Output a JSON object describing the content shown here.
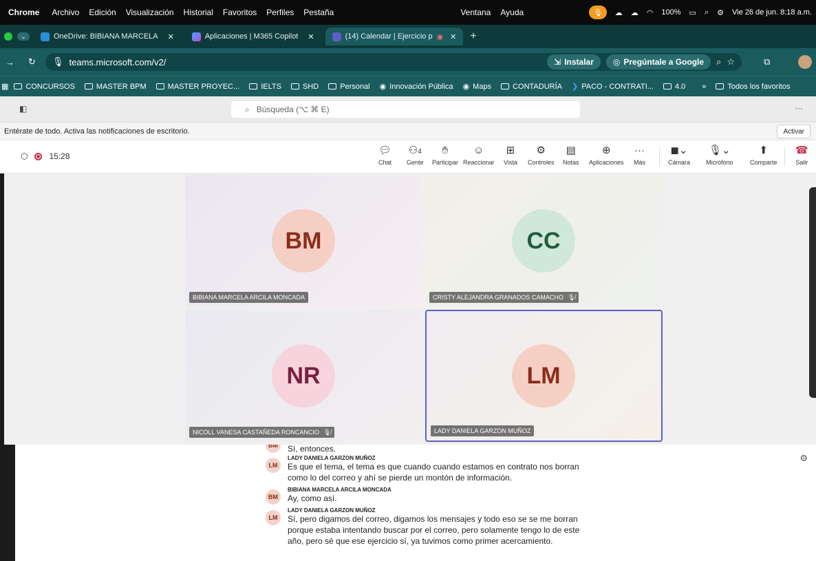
{
  "os_menubar": {
    "app": "Chrome",
    "items": [
      "Archivo",
      "Edición",
      "Visualización",
      "Historial",
      "Favoritos",
      "Perfiles",
      "Pestaña",
      "Ventana",
      "Ayuda"
    ],
    "battery": "100%",
    "datetime": "Vie 26 de jun.  8:18 a.m."
  },
  "browser": {
    "tabs": [
      {
        "label": "OneDrive: BIBIANA MARCELA",
        "active": false
      },
      {
        "label": "Aplicaciones | M365 Copilot",
        "active": false
      },
      {
        "label": "(14) Calendar | Ejercicio p",
        "active": true
      }
    ],
    "url": "teams.microsoft.com/v2/",
    "install_label": "Instalar",
    "google_label": "Pregúntale a Google",
    "bookmarks": [
      "CONCURSOS",
      "MASTER BPM",
      "MASTER PROYEC...",
      "IELTS",
      "SHD",
      "Personal",
      "Innovación Pública",
      "Maps",
      "CONTADURÍA",
      "PACO - CONTRATI...",
      "4.0"
    ],
    "all_bookmarks": "Todos los favoritos"
  },
  "teams": {
    "search_placeholder": "Búsqueda (⌥ ⌘ E)",
    "notification": "Entérate de todo. Activa las notificaciones de escritorio.",
    "notification_button": "Activar",
    "meeting_timer": "15:28",
    "people_count": "4",
    "toolbar": {
      "chat": "Chat",
      "people": "Gente",
      "raise": "Participar",
      "react": "Reaccionar",
      "view": "Vista",
      "controls": "Controles",
      "notes": "Notas",
      "apps": "Aplicaciones",
      "more": "Más",
      "camera": "Cámara",
      "mic": "Micrófono",
      "share": "Comparte",
      "leave": "Salir"
    },
    "participants": [
      {
        "initials": "BM",
        "name": "BIBIANA MARCELA ARCILA MONCADA",
        "muted": false
      },
      {
        "initials": "CC",
        "name": "CRISTY ALEJANDRA GRANADOS CAMACHO",
        "muted": true
      },
      {
        "initials": "NR",
        "name": "NICOLL VANESA CASTAÑEDA RONCANCIO",
        "muted": true
      },
      {
        "initials": "LM",
        "name": "LADY DANIELA GARZON MUÑOZ",
        "muted": false
      }
    ],
    "captions": [
      {
        "initials": "BM",
        "speaker": "",
        "text": "Sí, entonces."
      },
      {
        "initials": "LM",
        "speaker": "LADY DANIELA GARZON MUÑOZ",
        "text": "Es que el tema, el tema es que cuando cuando estamos en contrato nos borran como lo del correo y ahí se pierde un montón de información."
      },
      {
        "initials": "BM",
        "speaker": "BIBIANA MARCELA ARCILA MONCADA",
        "text": "Ay, como así."
      },
      {
        "initials": "LM",
        "speaker": "LADY DANIELA GARZON MUÑOZ",
        "text": "Sí, pero digamos del correo, digamos los mensajes y todo eso se se me borran porque estaba intentando buscar por el correo, pero solamente tengo lo de este año, pero sé que ese ejercicio sí, ya tuvimos como primer acercamiento."
      }
    ]
  }
}
